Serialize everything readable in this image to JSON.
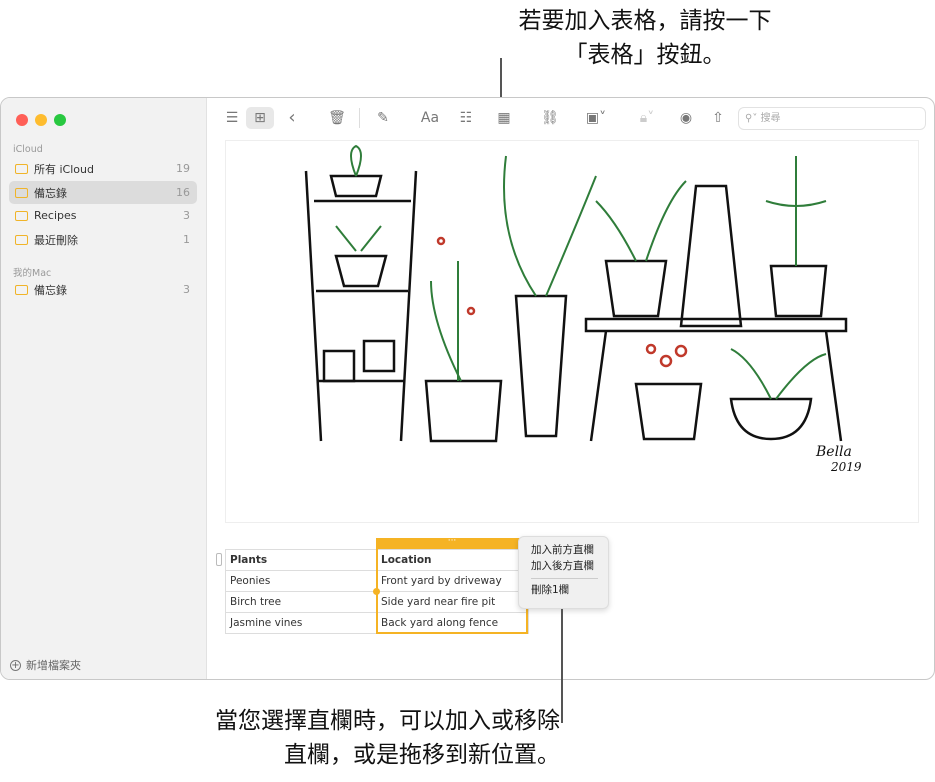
{
  "annotations": {
    "top": [
      "若要加入表格，請按一下",
      "「表格」按鈕。"
    ],
    "bottom": [
      "當您選擇直欄時，可以加入或移除",
      "直欄，或是拖移到新位置。"
    ]
  },
  "colors": {
    "accent": "#f5b324",
    "close": "#ff5f57",
    "minimize": "#febc2e",
    "zoom": "#28c840"
  },
  "sidebar": {
    "sections": [
      {
        "label": "iCloud",
        "items": [
          {
            "label": "所有 iCloud",
            "count": "19"
          },
          {
            "label": "備忘錄",
            "count": "16",
            "selected": true
          },
          {
            "label": "Recipes",
            "count": "3"
          },
          {
            "label": "最近刪除",
            "count": "1"
          }
        ]
      },
      {
        "label": "我的Mac",
        "items": [
          {
            "label": "備忘錄",
            "count": "3"
          }
        ]
      }
    ],
    "new_folder": "新增檔案夾"
  },
  "toolbar": {
    "icons": [
      "list-view-icon",
      "gallery-view-icon",
      "back-icon",
      "trash-icon",
      "compose-icon",
      "format-icon",
      "checklist-icon",
      "table-icon",
      "link-icon",
      "media-icon",
      "lock-icon",
      "collaborate-icon",
      "share-icon"
    ],
    "format_label": "Aa",
    "search_placeholder": "搜尋"
  },
  "note": {
    "drawing_signature": "Bella 2019",
    "table": {
      "headers": [
        "Plants",
        "Location"
      ],
      "rows": [
        [
          "Peonies",
          "Front yard by driveway"
        ],
        [
          "Birch tree",
          "Side yard near fire pit"
        ],
        [
          "Jasmine vines",
          "Back yard along fence"
        ]
      ]
    },
    "column_menu": {
      "items": [
        "加入前方直欄",
        "加入後方直欄",
        "刪除1欄"
      ]
    }
  }
}
